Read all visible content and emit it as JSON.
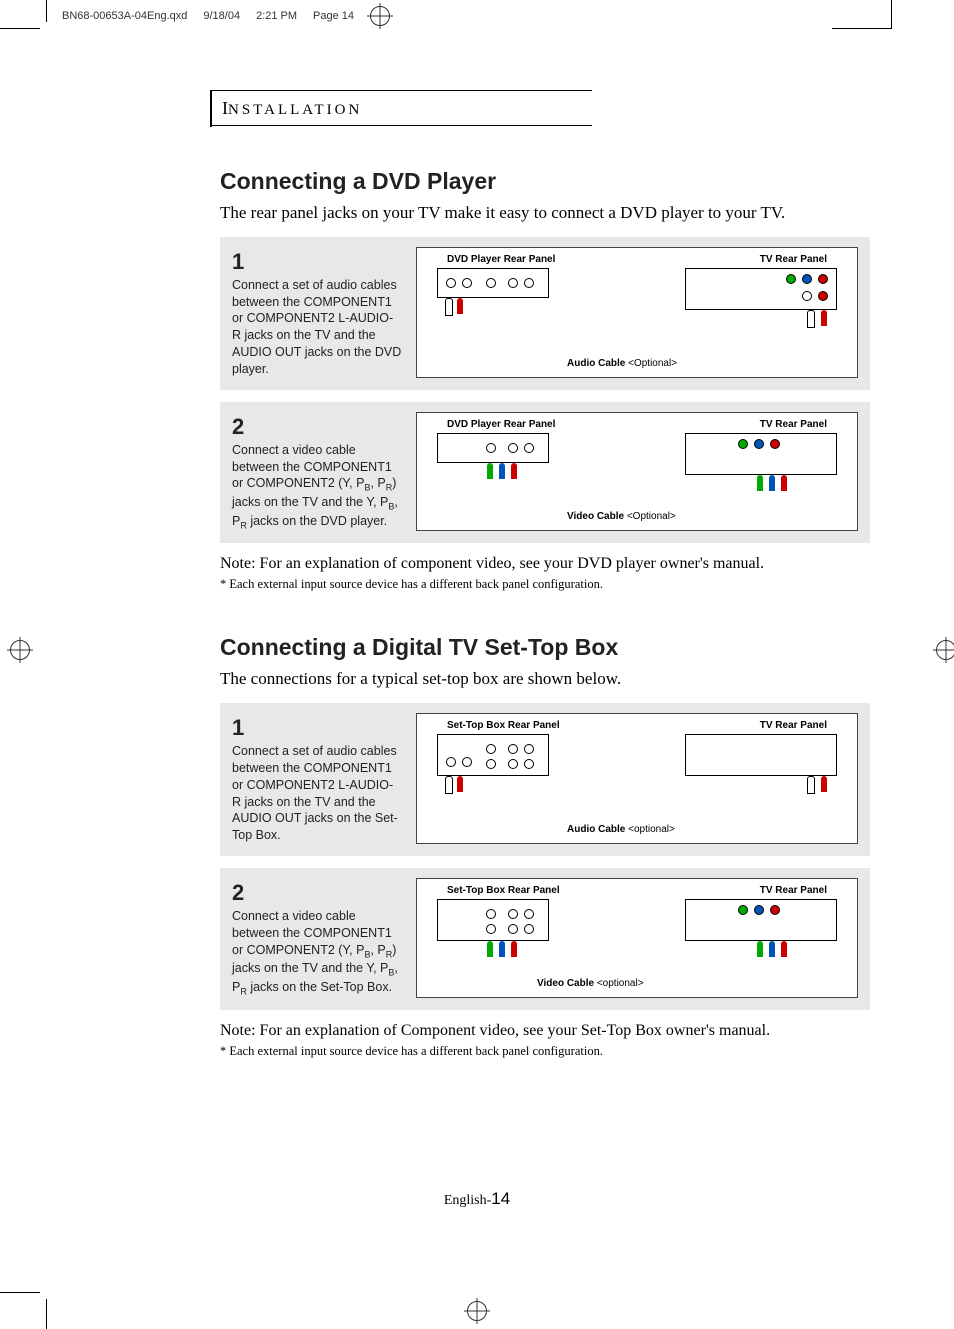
{
  "print_header": {
    "file": "BN68-00653A-04Eng.qxd",
    "date": "9/18/04",
    "time": "2:21 PM",
    "page": "Page 14"
  },
  "section_tab": "NSTALLATION",
  "section_tab_first": "I",
  "section1": {
    "title": "Connecting a DVD Player",
    "intro": "The rear panel jacks on your TV make it easy to connect a DVD player to your TV.",
    "step1_num": "1",
    "step1_text": "Connect a set of audio cables between the COMPONENT1 or COMPONENT2 L-AUDIO-R jacks on the TV and the AUDIO OUT jacks on the DVD player.",
    "step1_dlabel_left": "DVD Player Rear Panel",
    "step1_dlabel_right": "TV  Rear  Panel",
    "step1_cable": "Audio Cable",
    "step1_cable_opt": "<Optional>",
    "step2_num": "2",
    "step2_text_a": "Connect a video cable between the COMPONENT1 or COMPONENT2 (Y, P",
    "step2_text_b": ", P",
    "step2_text_c": ") jacks on the TV and the Y, P",
    "step2_text_d": ", P",
    "step2_text_e": " jacks on the DVD player.",
    "sub_b": "B",
    "sub_r": "R",
    "step2_dlabel_left": "DVD Player Rear Panel",
    "step2_dlabel_right": "TV  Rear  Panel",
    "step2_cable": "Video Cable",
    "step2_cable_opt": "<Optional>",
    "note": "Note: For an explanation of component video, see your DVD player owner's manual.",
    "subnote": "*  Each external input source device has a different back panel configuration."
  },
  "section2": {
    "title": "Connecting a Digital TV Set-Top Box",
    "intro": "The connections for a typical set-top box are shown below.",
    "step1_num": "1",
    "step1_text": "Connect a set of audio cables between the COMPONENT1 or COMPONENT2 L-AUDIO-R jacks on the TV and the AUDIO OUT jacks on the Set-Top Box.",
    "step1_dlabel_left": "Set-Top Box Rear Panel",
    "step1_dlabel_right": "TV  Rear  Panel",
    "step1_cable": "Audio Cable",
    "step1_cable_opt": "<optional>",
    "step2_num": "2",
    "step2_text_a": "Connect a video cable between the COMPONENT1 or COMPONENT2 (Y, P",
    "step2_text_b": ", P",
    "step2_text_c": ") jacks on the TV and the Y, P",
    "step2_text_d": ", P",
    "step2_text_e": " jacks on the Set-Top Box.",
    "step2_dlabel_left": "Set-Top Box Rear Panel",
    "step2_dlabel_right": "TV  Rear  Panel",
    "step2_cable": "Video Cable",
    "step2_cable_opt": "<optional>",
    "note": "Note: For an explanation of Component video, see your Set-Top Box owner's manual.",
    "subnote": "*  Each external input source device has a different back panel configuration."
  },
  "footer_lang": "English-",
  "footer_page": "14"
}
